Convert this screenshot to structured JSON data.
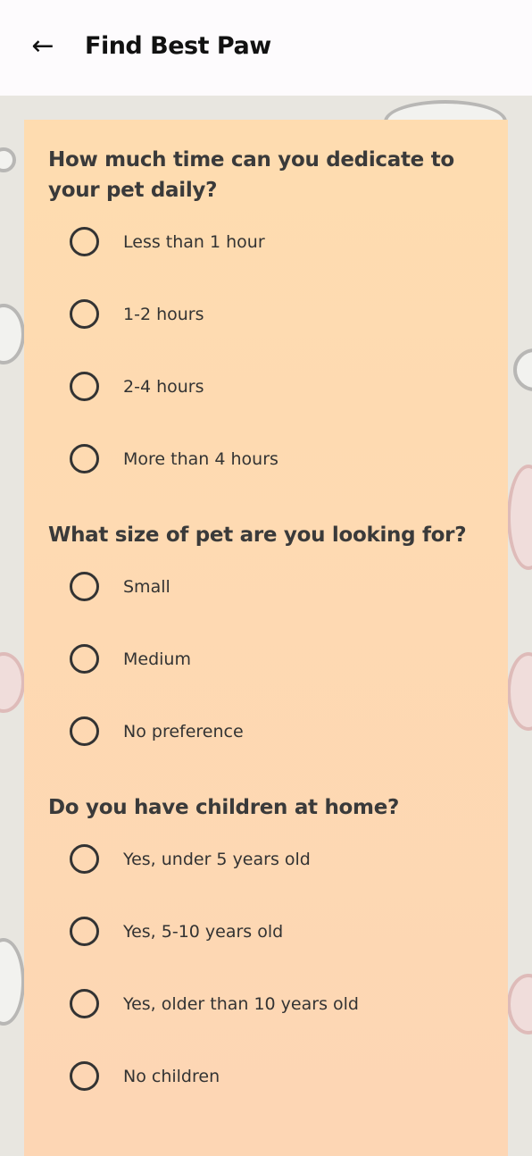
{
  "header": {
    "title": "Find Best Paw",
    "back_icon": "arrow-left-icon"
  },
  "questions": [
    {
      "text": "How much time can you dedicate to your pet daily?",
      "options": [
        "Less than 1 hour",
        "1-2 hours",
        "2-4 hours",
        "More than 4 hours"
      ]
    },
    {
      "text": "What size of pet are you looking for?",
      "options": [
        "Small",
        "Medium",
        "No preference"
      ]
    },
    {
      "text": "Do you have children at home?",
      "options": [
        "Yes, under 5 years old",
        "Yes, 5-10 years old",
        "Yes, older than 10 years old",
        "No children"
      ]
    }
  ]
}
